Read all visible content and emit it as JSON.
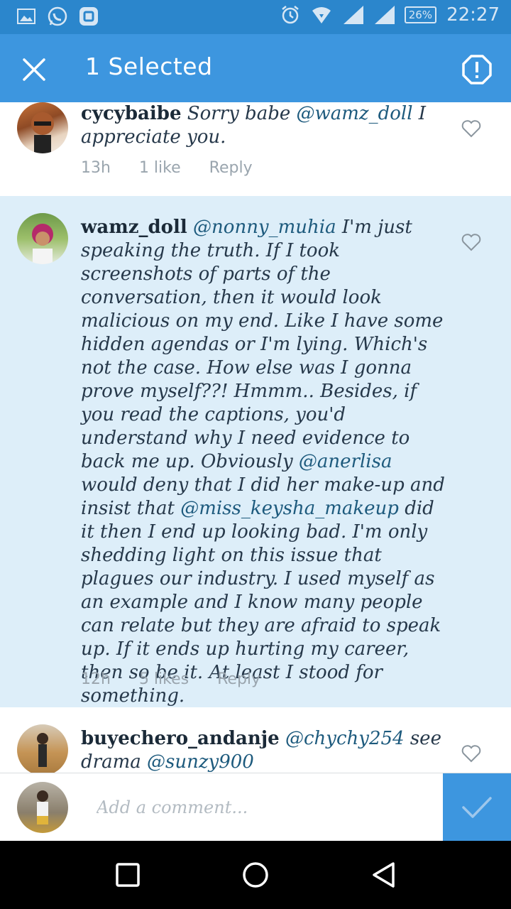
{
  "status_bar": {
    "battery": "26%",
    "time": "22:27"
  },
  "header": {
    "title": "1 Selected"
  },
  "comments": [
    {
      "username": "cycybaibe",
      "text_parts": [
        "Sorry babe ",
        "@wamz_doll",
        " I appreciate you."
      ],
      "time": "13h",
      "likes": "1 like",
      "reply": "Reply"
    },
    {
      "username": "wamz_doll",
      "text_parts": [
        "@nonny_muhia",
        " I'm just speaking the truth. If I took screenshots of parts of the conversation, then it would look malicious on my end. Like I have some hidden agendas or I'm lying. Which's not the case. How else was I gonna prove myself??! Hmmm.. Besides, if you read the captions, you'd understand why I need evidence to back me up. Obviously ",
        "@anerlisa",
        " would deny that I did her make-up and insist that ",
        "@miss_keysha_makeup",
        " did it then I end up looking bad. I'm only shedding light on this issue that plagues our industry. I used myself as an example and I know many people can relate but they are afraid to speak up. If it ends up hurting my career, then so be it. At least I stood for something."
      ],
      "time": "12h",
      "likes": "5 likes",
      "reply": "Reply"
    },
    {
      "username": "buyechero_andanje",
      "text_parts": [
        "@chychy254",
        " see drama ",
        "@sunzy900"
      ]
    }
  ],
  "input": {
    "placeholder": "Add a comment..."
  },
  "colors": {
    "accent": "#3d96df",
    "selected_bg": "#ddeef9",
    "status_bar": "#2b86cc"
  }
}
